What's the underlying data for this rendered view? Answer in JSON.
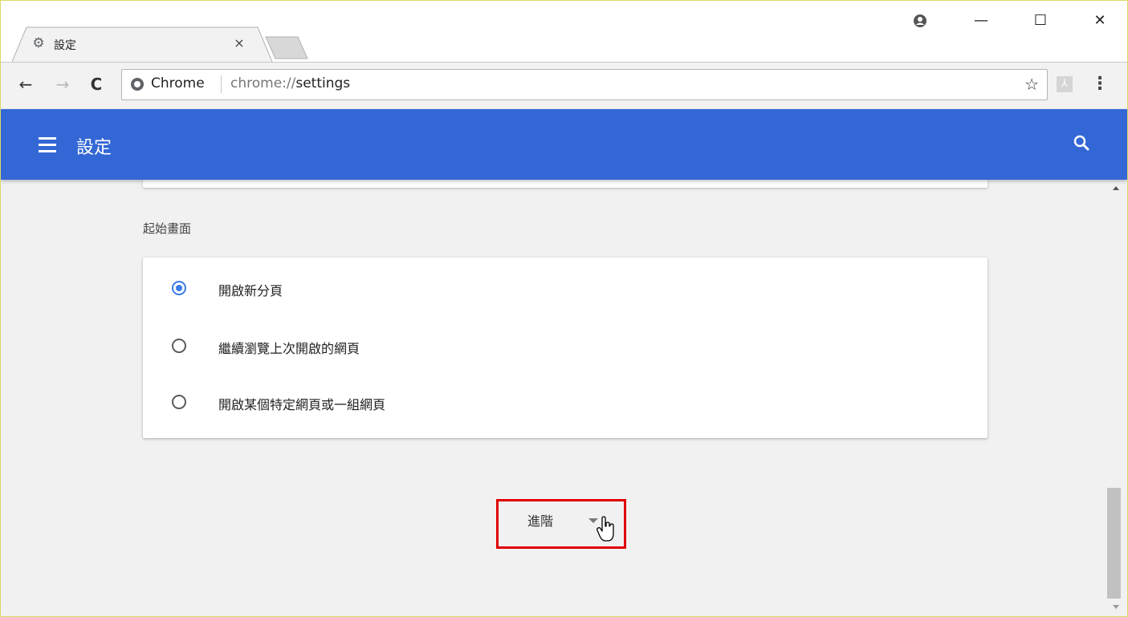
{
  "tab": {
    "title": "設定",
    "favicon": "gear-icon",
    "close": "×"
  },
  "window_controls": {
    "profile": "account-icon",
    "minimize": "—",
    "maximize": "☐",
    "close": "✕"
  },
  "toolbar": {
    "back": "←",
    "forward": "→",
    "reload": "C",
    "origin": "Chrome",
    "url_scheme": "chrome://",
    "url_path": "settings",
    "star": "☆",
    "menu": "⋮"
  },
  "header": {
    "title": "設定",
    "menu_icon": "hamburger-icon",
    "search_icon": "search-icon",
    "color": "#3367d6"
  },
  "startup": {
    "section_title": "起始畫面",
    "options": [
      {
        "label": "開啟新分頁",
        "checked": true
      },
      {
        "label": "繼續瀏覽上次開啟的網頁",
        "checked": false
      },
      {
        "label": "開啟某個特定網頁或一組網頁",
        "checked": false
      }
    ]
  },
  "advanced": {
    "label": "進階",
    "highlight_color": "#e00000"
  }
}
